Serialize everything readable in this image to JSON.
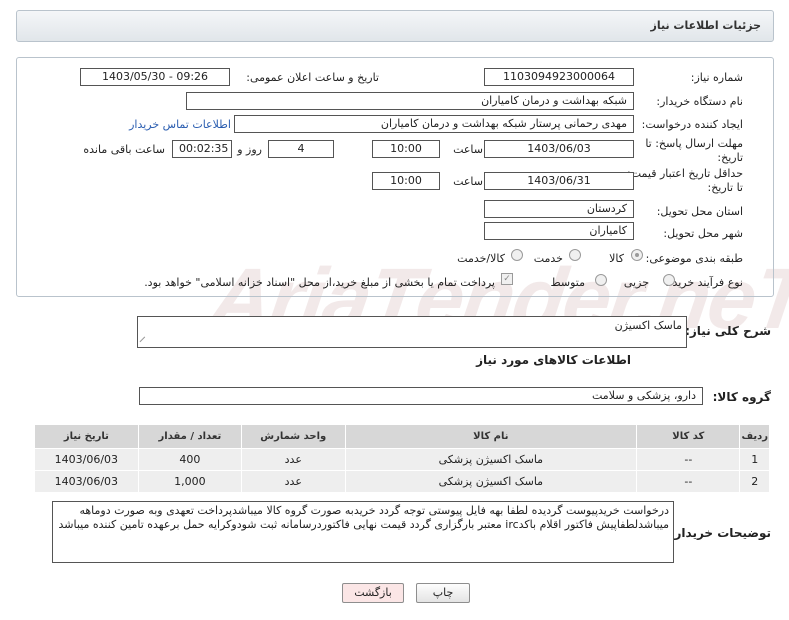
{
  "header": {
    "title": "جزئیات اطلاعات نیاز"
  },
  "form": {
    "need_number_label": "شماره نیاز:",
    "need_number": "1103094923000064",
    "announce_label": "تاریخ و ساعت اعلان عمومی:",
    "announce_value": "1403/05/30 - 09:26",
    "buyer_org_label": "نام دستگاه خریدار:",
    "buyer_org": "شبکه بهداشت و درمان کامیاران",
    "creator_label": "ایجاد کننده درخواست:",
    "creator": "مهدی رحمانی پرستار شبکه بهداشت و درمان کامیاران",
    "contact_link": "اطلاعات تماس خریدار",
    "reply_deadline_label": "مهلت ارسال پاسخ: تا تاریخ:",
    "reply_date": "1403/06/03",
    "time_label": "ساعت",
    "reply_time": "10:00",
    "days_value": "4",
    "days_label": "روز و",
    "remaining_time": "00:02:35",
    "remaining_label": "ساعت باقی مانده",
    "price_validity_label": "حداقل تاریخ اعتبار قیمت: تا تاریخ:",
    "validity_date": "1403/06/31",
    "validity_time": "10:00",
    "province_label": "استان محل تحویل:",
    "province": "کردستان",
    "city_label": "شهر محل تحویل:",
    "city": "کامیاران",
    "category_label": "طبقه بندی موضوعی:",
    "category_options": [
      "کالا",
      "خدمت",
      "کالا/خدمت"
    ],
    "category_selected": "کالا",
    "process_label": "نوع فرآیند خرید :",
    "process_options": [
      "جزیی",
      "متوسط"
    ],
    "payment_note": "پرداخت تمام یا بخشی از مبلغ خرید،از محل \"اسناد خزانه اسلامی\" خواهد بود."
  },
  "summary": {
    "label": "شرح کلی نیاز:",
    "value": "ماسک اکسیژن"
  },
  "goods": {
    "section_title": "اطلاعات کالاهای مورد نیاز",
    "group_label": "گروه کالا:",
    "group_value": "دارو، پزشکی و سلامت",
    "columns": [
      "ردیف",
      "کد کالا",
      "نام کالا",
      "واحد شمارش",
      "تعداد / مقدار",
      "تاریخ نیاز"
    ],
    "rows": [
      {
        "row": "1",
        "code": "--",
        "name": "ماسک اکسیژن پزشکی",
        "unit": "عدد",
        "qty": "400",
        "date": "1403/06/03"
      },
      {
        "row": "2",
        "code": "--",
        "name": "ماسک اکسیژن پزشکی",
        "unit": "عدد",
        "qty": "1,000",
        "date": "1403/06/03"
      }
    ]
  },
  "buyer_notes": {
    "label": "توضیحات خریدار:",
    "text": "درخواست خریدپیوست گردیده لطفا بهه فایل پیوستی توجه گردد خریدبه صورت گروه کالا میباشدپرداخت تعهدی وبه صورت دوماهه میباشدلطفاپیش فاکتور اقلام باکدirc معتبر بارگزاری گردد قیمت نهایی فاکتوردرسامانه ثبت شودوکرایه حمل برعهده تامین کننده میباشد"
  },
  "buttons": {
    "print": "چاپ",
    "back": "بازگشت"
  },
  "watermark": "AriaTender.neT"
}
